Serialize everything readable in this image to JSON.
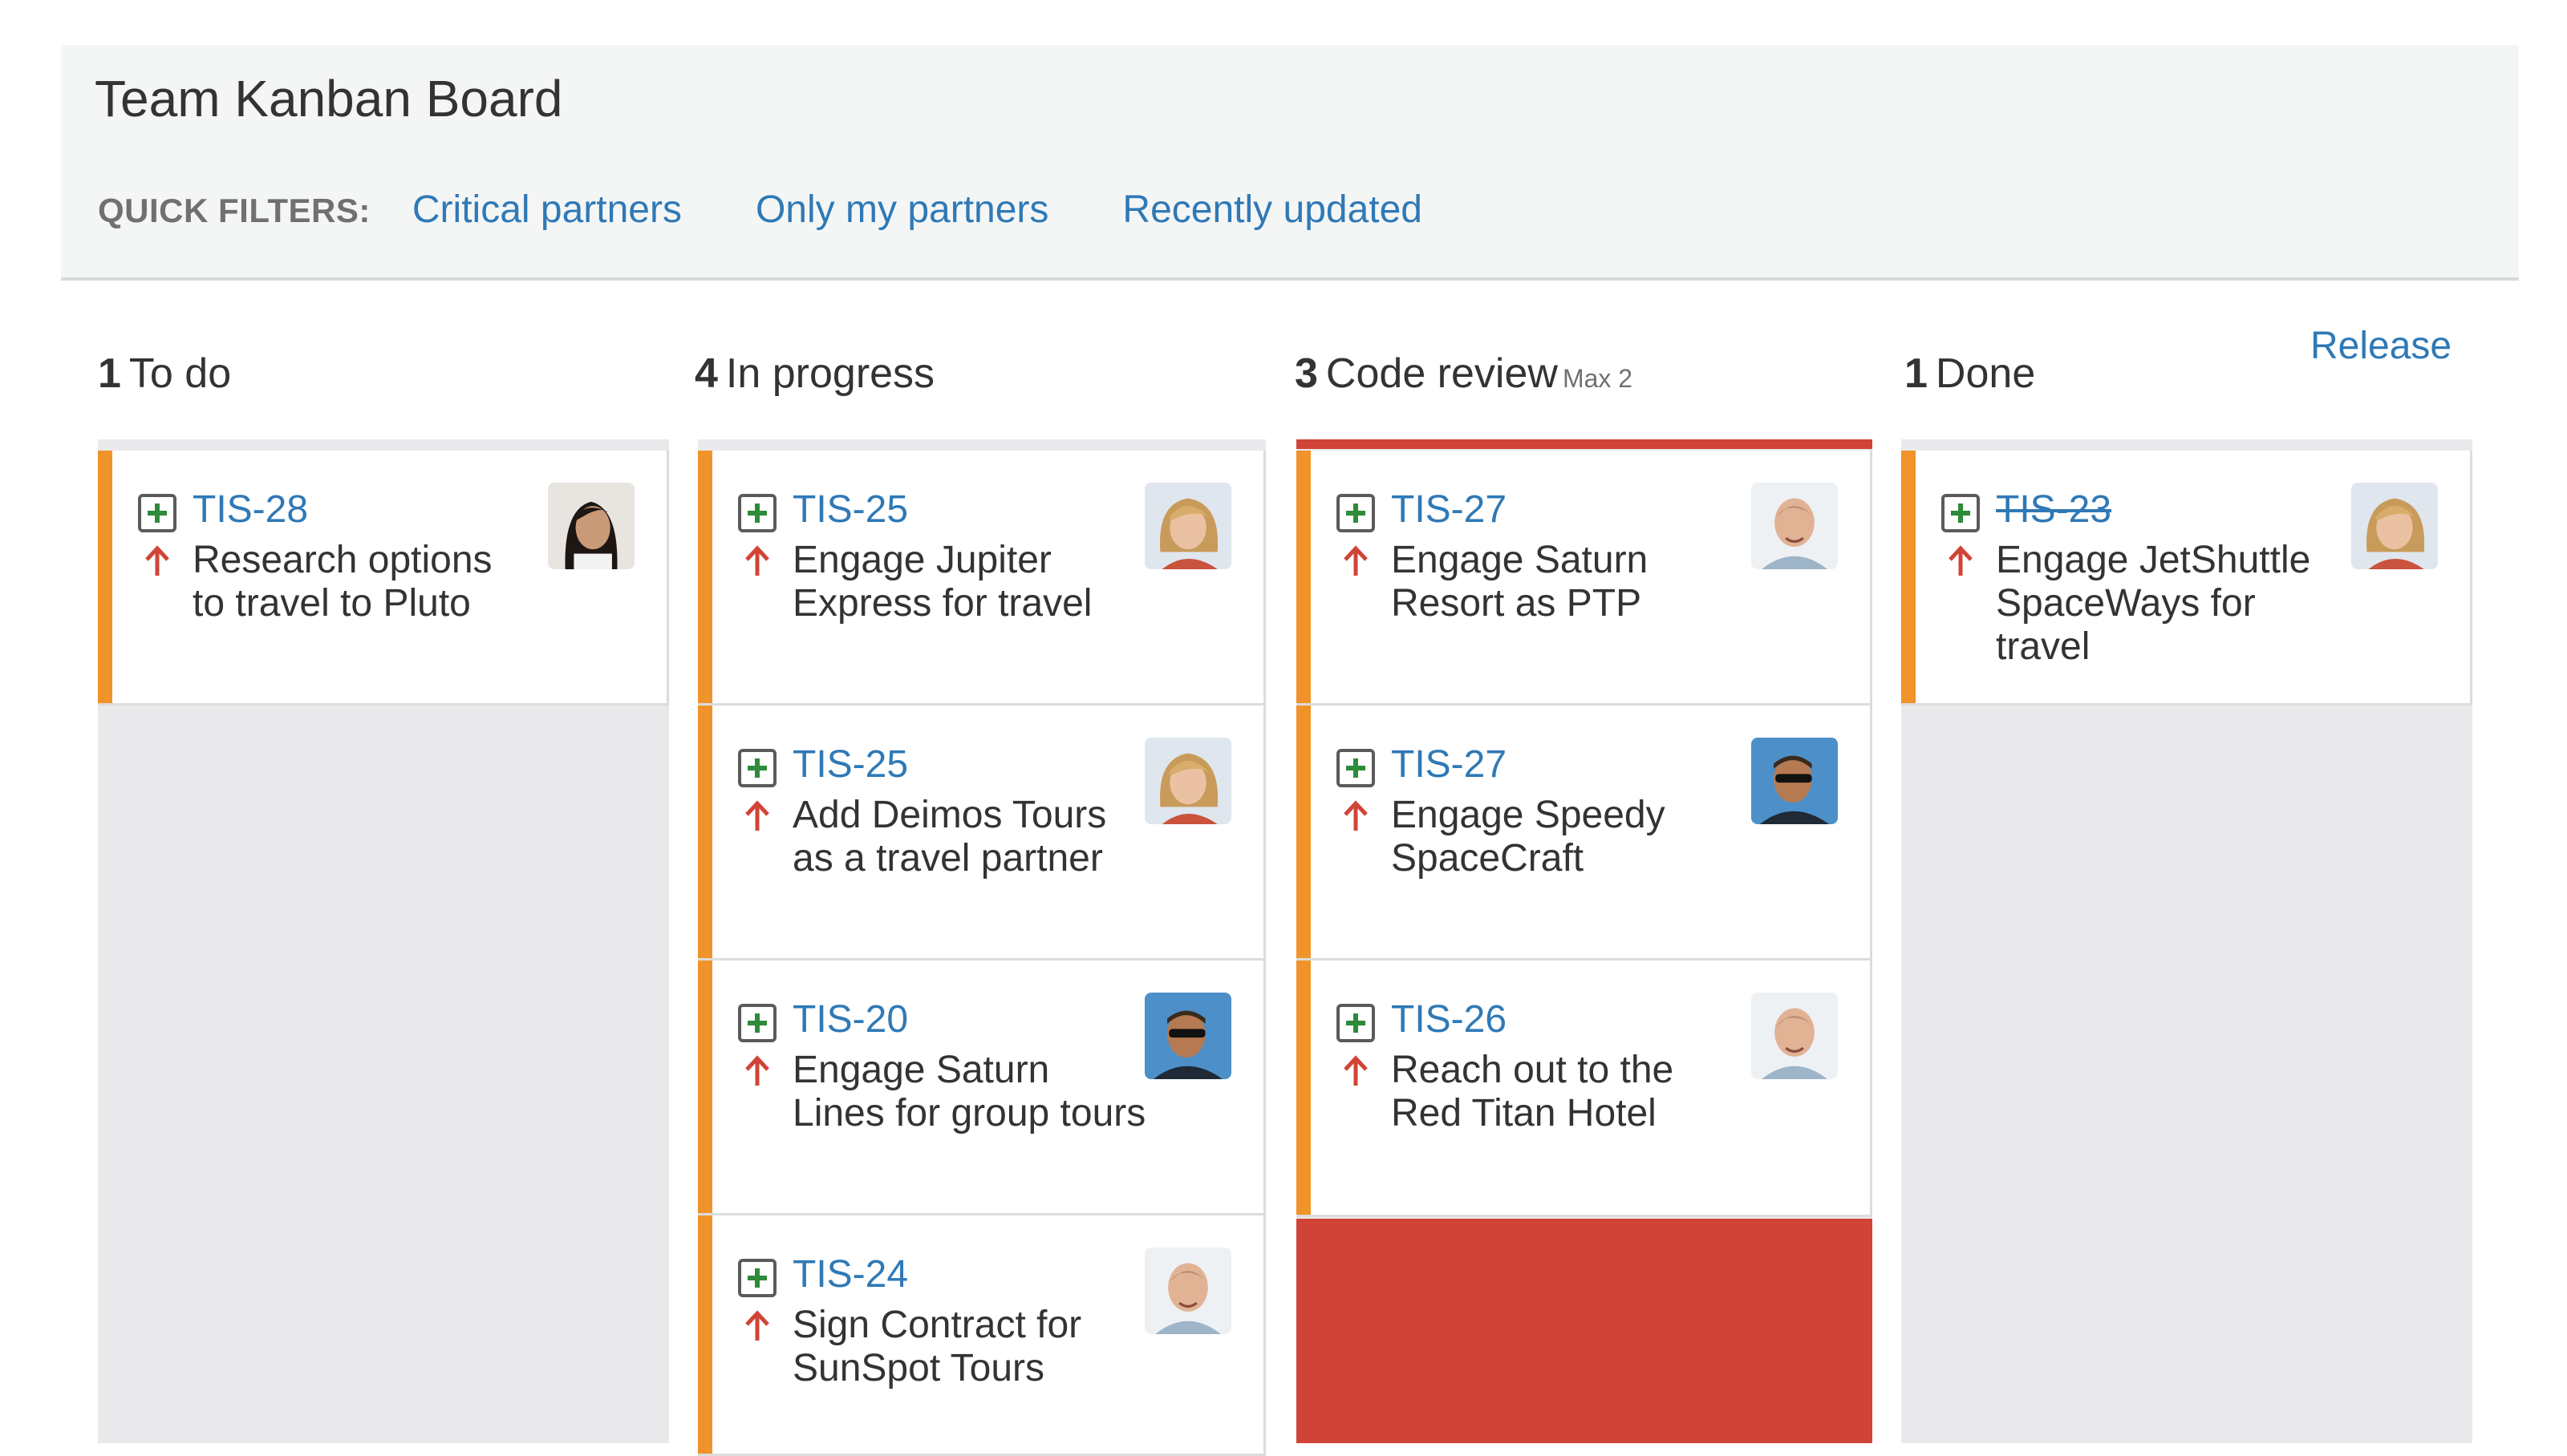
{
  "board": {
    "title": "Team Kanban Board",
    "quick_filters_label": "QUICK FILTERS:",
    "quick_filters": [
      "Critical partners",
      "Only my partners",
      "Recently updated"
    ],
    "release_label": "Release"
  },
  "columns": [
    {
      "count": "1",
      "name": "To do",
      "max": "",
      "cards": [
        {
          "key": "TIS-28",
          "summary_lines": [
            "Research options",
            "to travel to Pluto"
          ],
          "avatar": "avatar-woman-dark-hair",
          "done": false
        }
      ]
    },
    {
      "count": "4",
      "name": "In progress",
      "max": "",
      "cards": [
        {
          "key": "TIS-25",
          "summary_lines": [
            "Engage Jupiter",
            "Express for travel"
          ],
          "avatar": "avatar-woman-blonde",
          "done": false
        },
        {
          "key": "TIS-25",
          "summary_lines": [
            "Add Deimos Tours",
            "as a travel partner"
          ],
          "avatar": "avatar-woman-blonde",
          "done": false
        },
        {
          "key": "TIS-20",
          "summary_lines": [
            "Engage Saturn",
            "Lines for group tours"
          ],
          "avatar": "avatar-man-sunglasses",
          "done": false
        },
        {
          "key": "TIS-24",
          "summary_lines": [
            "Sign Contract for",
            "SunSpot Tours"
          ],
          "avatar": "avatar-man-bald",
          "done": false
        }
      ]
    },
    {
      "count": "3",
      "name": "Code review",
      "max": "Max 2",
      "cards": [
        {
          "key": "TIS-27",
          "summary_lines": [
            "Engage Saturn",
            "Resort as PTP"
          ],
          "avatar": "avatar-man-bald",
          "done": false
        },
        {
          "key": "TIS-27",
          "summary_lines": [
            "Engage Speedy",
            "SpaceCraft"
          ],
          "avatar": "avatar-man-sunglasses",
          "done": false
        },
        {
          "key": "TIS-26",
          "summary_lines": [
            "Reach out to the",
            "Red Titan Hotel"
          ],
          "avatar": "avatar-man-bald",
          "done": false
        }
      ]
    },
    {
      "count": "1",
      "name": "Done",
      "max": "",
      "cards": [
        {
          "key": "TIS-23",
          "summary_lines": [
            "Engage JetShuttle",
            "SpaceWays for",
            "travel"
          ],
          "avatar": "avatar-woman-blonde",
          "done": true
        }
      ]
    }
  ],
  "colors": {
    "link": "#2f79b6",
    "flag": "#f0932a",
    "over_limit": "#d04437",
    "priority": "#d04437",
    "column_bg": "#e9e9eb",
    "header_bg": "#f4f6f6"
  },
  "icons": {
    "issue_type": "story-add-icon",
    "priority": "priority-major-arrow-up-icon"
  }
}
